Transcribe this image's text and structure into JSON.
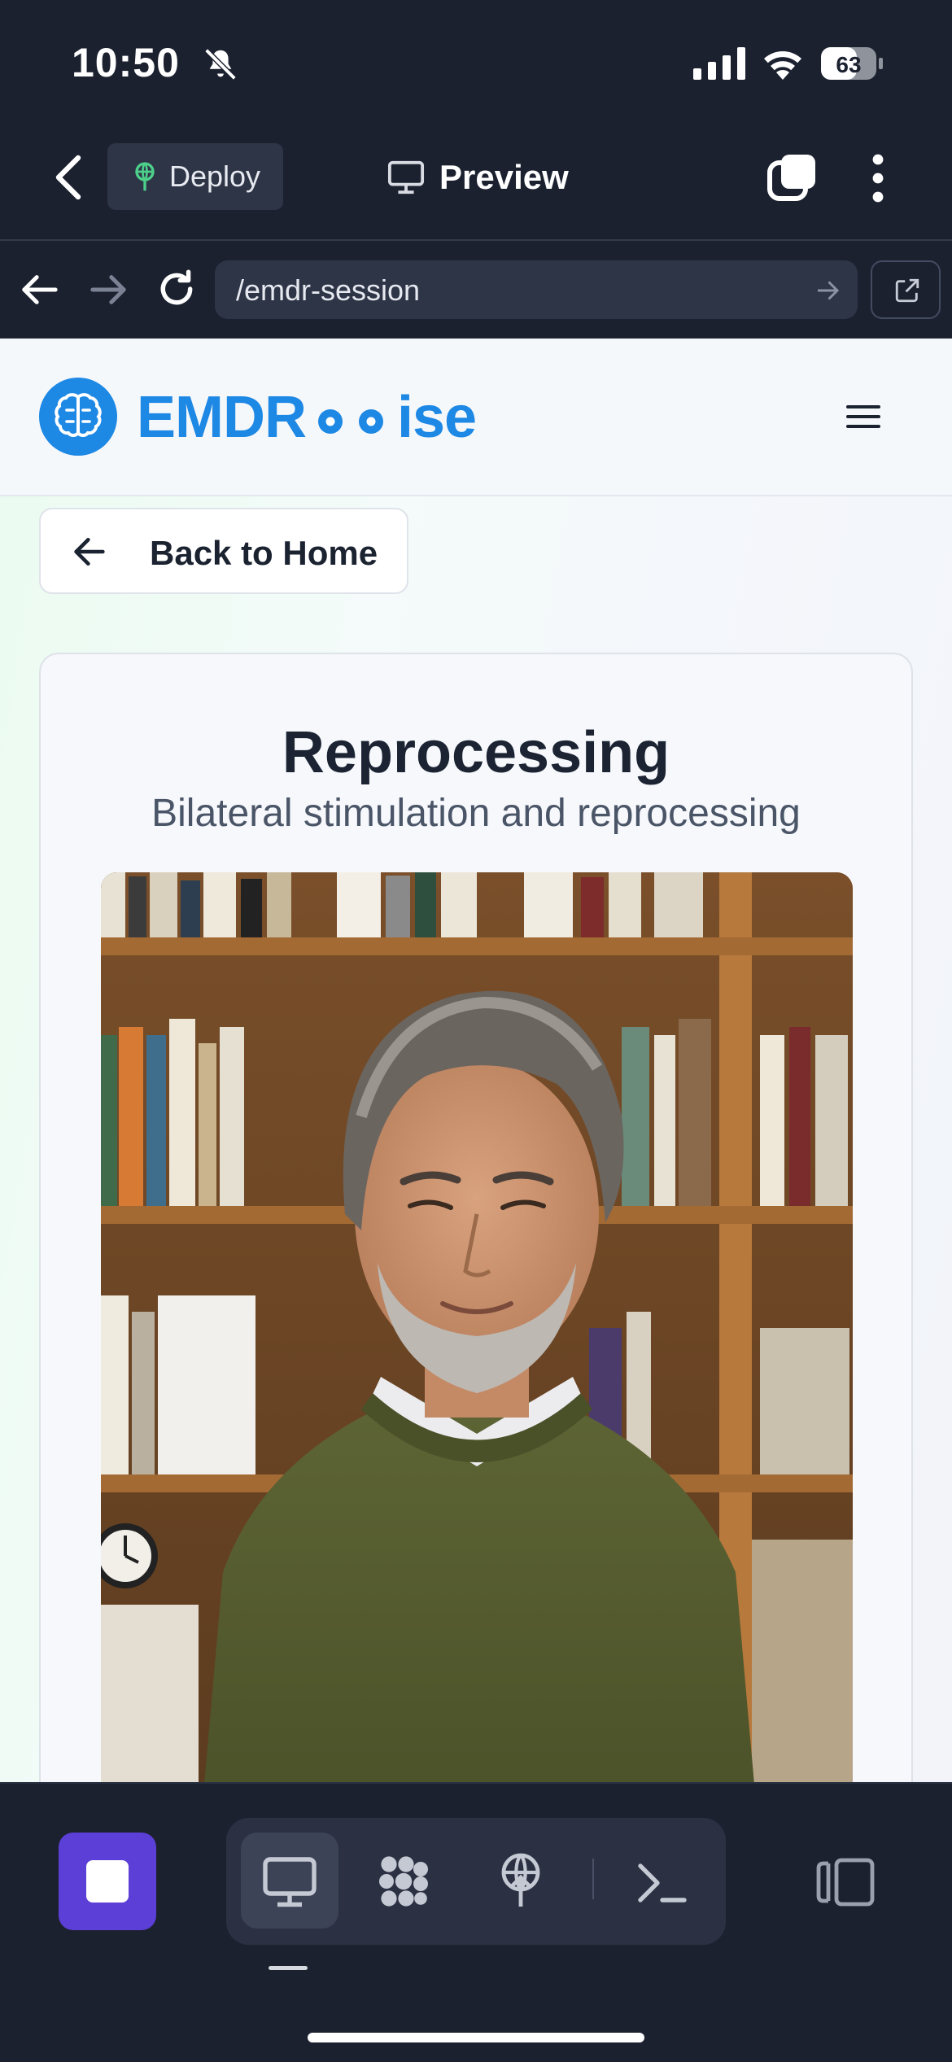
{
  "status_bar": {
    "time": "10:50",
    "battery_level": "63",
    "icons": [
      "bell-slash-icon",
      "cellular-signal-icon",
      "wifi-icon",
      "battery-icon"
    ]
  },
  "top_bar": {
    "back_icon": "chevron-left-icon",
    "deploy_label": "Deploy",
    "deploy_icon": "antenna-icon",
    "preview_label": "Preview",
    "preview_icon": "monitor-icon",
    "tabs_icon": "tabs-icon",
    "menu_icon": "kebab-menu-icon"
  },
  "url_bar": {
    "url": "/emdr-session",
    "nav_icons": [
      "arrow-left-icon",
      "arrow-right-icon",
      "reload-icon",
      "external-link-icon"
    ]
  },
  "site": {
    "brand": {
      "prefix": "EMDR",
      "suffix": "ise"
    },
    "back_button": "Back to Home",
    "card": {
      "title": "Reprocessing",
      "subtitle": "Bilateral stimulation and reprocessing",
      "image_icon": "therapist-portrait"
    }
  },
  "bottom_toolbar": {
    "items": [
      "stop-icon",
      "desktop-icon",
      "cluster-icon",
      "deploy-icon",
      "terminal-icon",
      "split-view-icon"
    ],
    "active_item": "desktop-icon"
  },
  "colors": {
    "app_background": "#1c2130",
    "brand_blue": "#1e88e5",
    "stop_purple": "#5b3fd6",
    "deploy_green": "#4cd08a"
  }
}
